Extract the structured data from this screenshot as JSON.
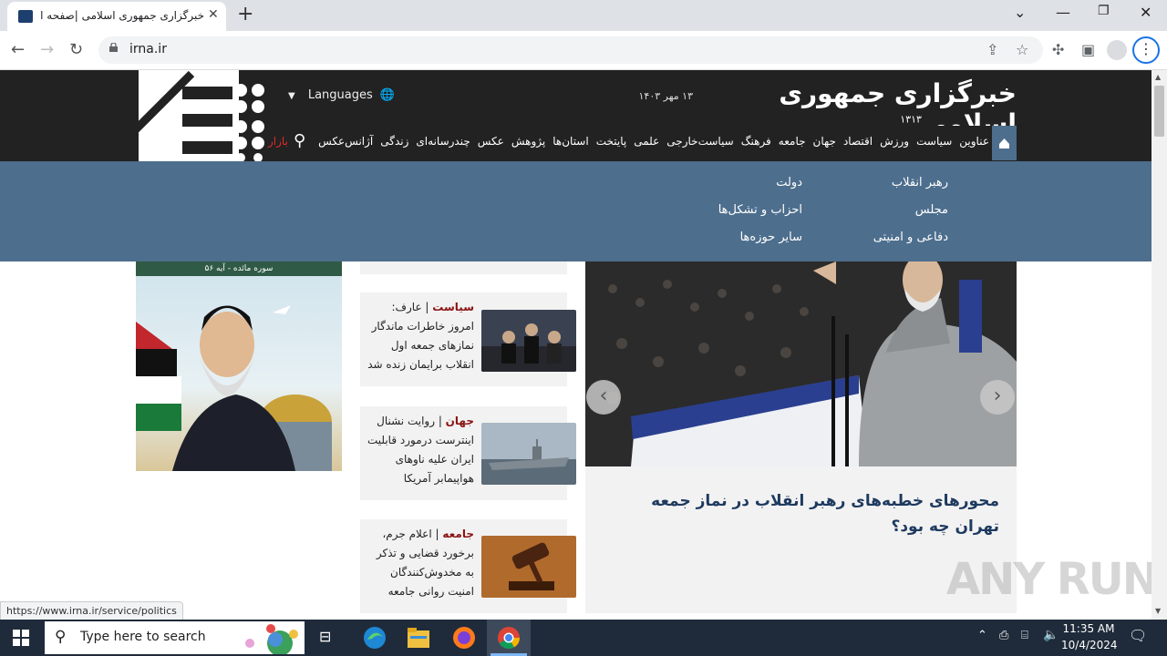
{
  "browser": {
    "tab_title": "خبرگزاری جمهوری اسلامی |صفحه اول",
    "url": "irna.ir",
    "status_url": "https://www.irna.ir/service/politics"
  },
  "site": {
    "title": "خبرگزاری جمهوری اسلامی",
    "year_mark": "۱۳۱۳",
    "date": "۱۳ مهر ۱۴۰۳",
    "languages_label": "Languages",
    "bazar_label": "بازار",
    "nav_items": [
      "عناوین",
      "سیاست",
      "ورزش",
      "اقتصاد",
      "جهان",
      "جامعه",
      "فرهنگ",
      "سیاست‌خارجی",
      "علمی",
      "پایتخت",
      "استان‌ها",
      "پژوهش",
      "عکس",
      "چندرسانه‌ای",
      "زندگی",
      "آژانس‌عکس"
    ]
  },
  "dropdown": {
    "col1": [
      "رهبر انقلاب",
      "مجلس",
      "دفاعی و امنیتی"
    ],
    "col2": [
      "دولت",
      "احزاب و تشکل‌ها",
      "سایر حوزه‌ها"
    ]
  },
  "news": [
    {
      "category": "سیاست",
      "text": "عارف: امروز خاطرات ماندگار نمازهای جمعه اول انقلاب برایمان زنده شد"
    },
    {
      "category": "جهان",
      "text": "روایت نشنال اینترست درمورد قابلیت ایران علیه ناوهای هواپیمابر آمریکا"
    },
    {
      "category": "جامعه",
      "text": "اعلام جرم، برخورد قضایی و تذکر به مخدوش‌کنندگان امنیت روانی جامعه"
    }
  ],
  "main_headline": "محورهای خطبه‌های رهبر انقلاب در نماز جمعه تهران چه بود؟",
  "banner_caption": "سوره مائده - آیه ۵۶",
  "watermark": "ANY RUN",
  "taskbar": {
    "search_placeholder": "Type here to search",
    "time": "11:35 AM",
    "date": "10/4/2024"
  },
  "colors": {
    "header_bg": "#222222",
    "nav_accent": "#4d6e8d",
    "category_red": "#8a1212",
    "headline_blue": "#1e3a5f"
  }
}
